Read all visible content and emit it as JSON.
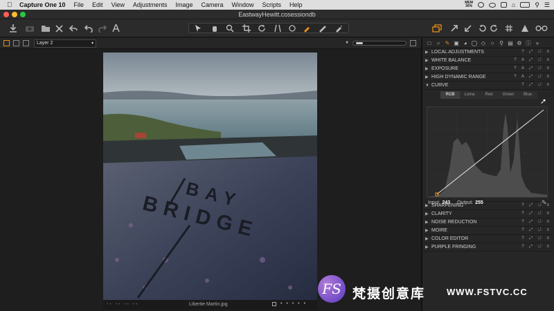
{
  "menubar": {
    "app": "Capture One 10",
    "items": [
      "File",
      "Edit",
      "View",
      "Adjustments",
      "Image",
      "Camera",
      "Window",
      "Scripts",
      "Help"
    ],
    "mem_label": "MEM",
    "mem_value": "36%"
  },
  "window": {
    "title": "EastwayHewitt.cosessiondb"
  },
  "subbar": {
    "layer": "Layer 2"
  },
  "viewer": {
    "filename": "Libertie Martin.jpg",
    "sign_line1": "BAY",
    "sign_line2": "BRIDGE"
  },
  "tools": {
    "top": [
      {
        "label": "LOCAL ADJUSTMENTS",
        "expanded": false
      },
      {
        "label": "WHITE BALANCE",
        "expanded": false
      },
      {
        "label": "EXPOSURE",
        "expanded": false
      },
      {
        "label": "HIGH DYNAMIC RANGE",
        "expanded": false
      },
      {
        "label": "CURVE",
        "expanded": true
      }
    ],
    "bottom": [
      {
        "label": "SHARPENING",
        "expanded": false
      },
      {
        "label": "CLARITY",
        "expanded": false
      },
      {
        "label": "NOISE REDUCTION",
        "expanded": false
      },
      {
        "label": "MOIRE",
        "expanded": false
      },
      {
        "label": "COLOR EDITOR",
        "expanded": false
      },
      {
        "label": "PURPLE FRINGING",
        "expanded": false
      }
    ]
  },
  "curve": {
    "channels": [
      "RGB",
      "Luma",
      "Red",
      "Green",
      "Blue"
    ],
    "active_channel": "RGB",
    "input_label": "Input:",
    "input_value": "243",
    "output_label": "Output:",
    "output_value": "255"
  },
  "watermark": {
    "logo": "FS",
    "chinese": "梵摄创意库",
    "url": "WWW.FSTVC.CC"
  },
  "colors": {
    "accent": "#e8901c",
    "panel": "#262626",
    "background": "#1e1e1e"
  }
}
